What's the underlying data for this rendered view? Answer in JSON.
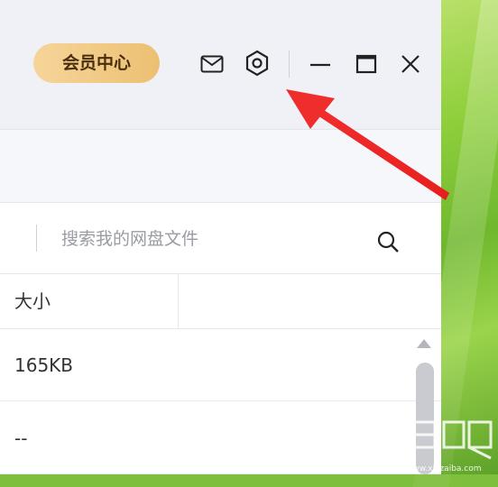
{
  "header": {
    "vip_label": "会员中心"
  },
  "icons": {
    "mail": "mail-icon",
    "settings": "settings-icon",
    "minimize": "minimize-icon",
    "maximize": "maximize-icon",
    "close": "close-icon",
    "search": "search-icon"
  },
  "search": {
    "placeholder": "搜索我的网盘文件"
  },
  "table": {
    "columns": [
      "大小"
    ],
    "rows": [
      "165KB",
      "--"
    ]
  },
  "colors": {
    "vip_gradient_start": "#f6d59a",
    "vip_gradient_end": "#ecc072",
    "annotation_arrow": "#f02d2d",
    "titlebar_bg": "#f0f1f7"
  }
}
